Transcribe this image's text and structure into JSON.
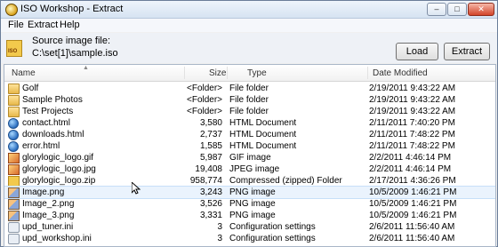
{
  "window": {
    "title": "ISO Workshop - Extract"
  },
  "menu": [
    "File",
    "Extract",
    "Help"
  ],
  "source": {
    "label": "Source image file:",
    "path": "C:\\set[1]\\sample.iso",
    "icon_text": "ISO"
  },
  "buttons": {
    "load": "Load",
    "extract": "Extract"
  },
  "columns": {
    "name": "Name",
    "size": "Size",
    "type": "Type",
    "date": "Date Modified"
  },
  "rows": [
    {
      "name": "Golf",
      "size": "<Folder>",
      "type": "File folder",
      "date": "2/19/2011 9:43:22 AM",
      "icon": "folder-icon"
    },
    {
      "name": "Sample Photos",
      "size": "<Folder>",
      "type": "File folder",
      "date": "2/19/2011 9:43:22 AM",
      "icon": "folder-icon"
    },
    {
      "name": "Test Projects",
      "size": "<Folder>",
      "type": "File folder",
      "date": "2/19/2011 9:43:22 AM",
      "icon": "folder-icon"
    },
    {
      "name": "contact.html",
      "size": "3,580",
      "type": "HTML Document",
      "date": "2/11/2011 7:40:20 PM",
      "icon": "html-icon"
    },
    {
      "name": "downloads.html",
      "size": "2,737",
      "type": "HTML Document",
      "date": "2/11/2011 7:48:22 PM",
      "icon": "html-icon"
    },
    {
      "name": "error.html",
      "size": "1,585",
      "type": "HTML Document",
      "date": "2/11/2011 7:48:22 PM",
      "icon": "html-icon"
    },
    {
      "name": "glorylogic_logo.gif",
      "size": "5,987",
      "type": "GIF image",
      "date": "2/2/2011 4:46:14 PM",
      "icon": "image-icon"
    },
    {
      "name": "glorylogic_logo.jpg",
      "size": "19,408",
      "type": "JPEG image",
      "date": "2/2/2011 4:46:14 PM",
      "icon": "image-icon"
    },
    {
      "name": "glorylogic_logo.zip",
      "size": "958,774",
      "type": "Compressed (zipped) Folder",
      "date": "2/17/2011 4:36:26 PM",
      "icon": "zip-icon"
    },
    {
      "name": "Image.png",
      "size": "3,243",
      "type": "PNG image",
      "date": "10/5/2009 1:46:21 PM",
      "icon": "png-icon"
    },
    {
      "name": "Image_2.png",
      "size": "3,526",
      "type": "PNG image",
      "date": "10/5/2009 1:46:21 PM",
      "icon": "png-icon"
    },
    {
      "name": "Image_3.png",
      "size": "3,331",
      "type": "PNG image",
      "date": "10/5/2009 1:46:21 PM",
      "icon": "png-icon"
    },
    {
      "name": "upd_tuner.ini",
      "size": "3",
      "type": "Configuration settings",
      "date": "2/6/2011 11:56:40 AM",
      "icon": "ini-icon"
    },
    {
      "name": "upd_workshop.ini",
      "size": "3",
      "type": "Configuration settings",
      "date": "2/6/2011 11:56:40 AM",
      "icon": "ini-icon"
    }
  ]
}
